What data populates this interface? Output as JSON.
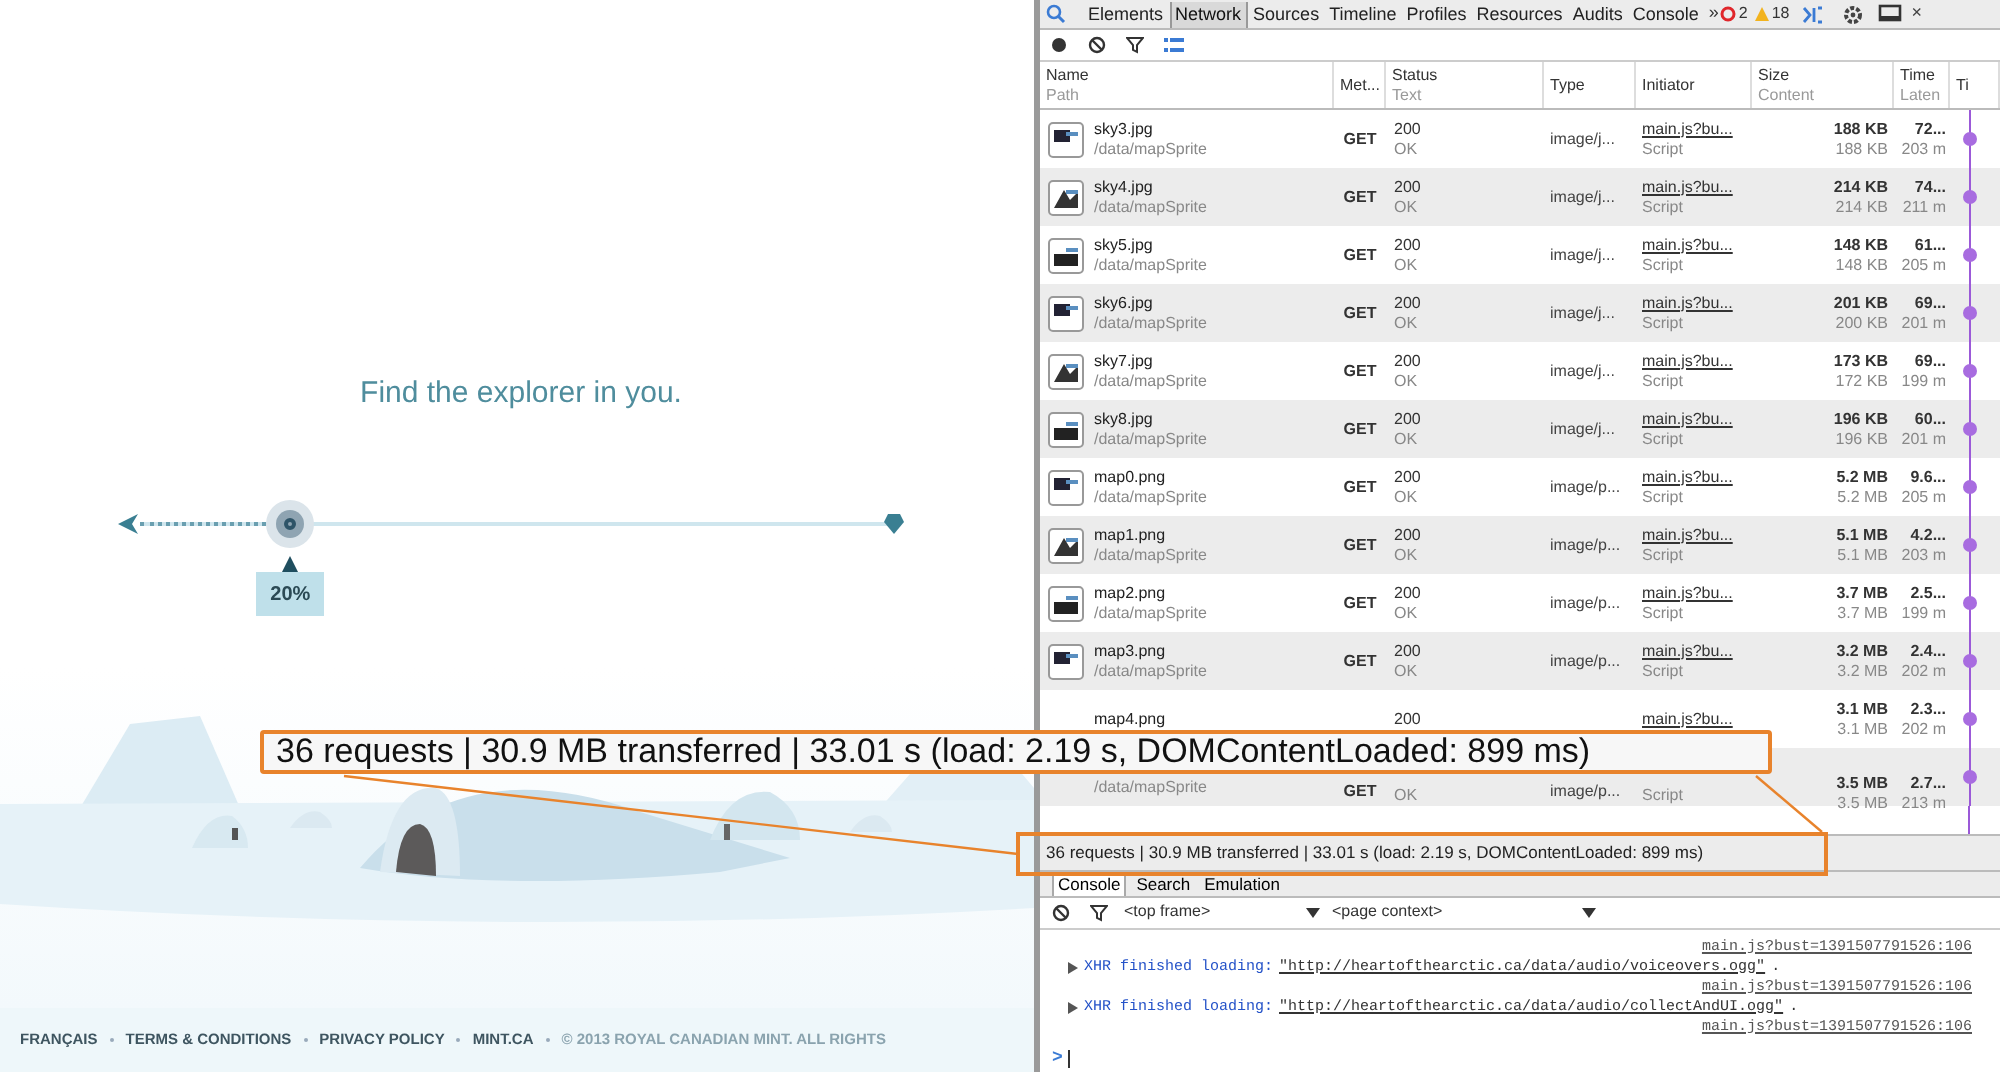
{
  "site": {
    "heading": "Find the explorer in you.",
    "slider": {
      "level": 0.2,
      "label": "20%"
    },
    "footer_links": [
      "FRANÇAIS",
      "TERMS & CONDITIONS",
      "PRIVACY POLICY",
      "MINT.CA"
    ],
    "copyright": "© 2013 ROYAL CANADIAN MINT. ALL RIGHTS"
  },
  "devtools": {
    "tabs": [
      {
        "label": "Elements",
        "selected": false
      },
      {
        "label": "Network",
        "selected": true
      },
      {
        "label": "Sources",
        "selected": false
      },
      {
        "label": "Timeline",
        "selected": false
      },
      {
        "label": "Profiles",
        "selected": false
      },
      {
        "label": "Resources",
        "selected": false
      },
      {
        "label": "Audits",
        "selected": false
      },
      {
        "label": "Console",
        "selected": false
      }
    ],
    "more": "»",
    "errors": "2",
    "warnings": "18",
    "close": "×",
    "columns": [
      {
        "title": "Name",
        "subtitle": "Path"
      },
      {
        "title": "Met..."
      },
      {
        "title": "Status",
        "subtitle": "Text"
      },
      {
        "title": "Type"
      },
      {
        "title": "Initiator"
      },
      {
        "title": "Size",
        "subtitle": "Content"
      },
      {
        "title": "Time",
        "subtitle": "Laten"
      },
      {
        "title": "Ti"
      }
    ],
    "rows": [
      {
        "name": "sky3.jpg",
        "path": "/data/mapSprite",
        "method": "GET",
        "status": "200",
        "status_text": "OK",
        "type": "image/j...",
        "initiator": "main.js?bu...",
        "initiator_type": "Script",
        "size": "188 KB",
        "content": "188 KB",
        "time": "72...",
        "latency": "203 m"
      },
      {
        "name": "sky4.jpg",
        "path": "/data/mapSprite",
        "method": "GET",
        "status": "200",
        "status_text": "OK",
        "type": "image/j...",
        "initiator": "main.js?bu...",
        "initiator_type": "Script",
        "size": "214 KB",
        "content": "214 KB",
        "time": "74...",
        "latency": "211 m"
      },
      {
        "name": "sky5.jpg",
        "path": "/data/mapSprite",
        "method": "GET",
        "status": "200",
        "status_text": "OK",
        "type": "image/j...",
        "initiator": "main.js?bu...",
        "initiator_type": "Script",
        "size": "148 KB",
        "content": "148 KB",
        "time": "61...",
        "latency": "205 m"
      },
      {
        "name": "sky6.jpg",
        "path": "/data/mapSprite",
        "method": "GET",
        "status": "200",
        "status_text": "OK",
        "type": "image/j...",
        "initiator": "main.js?bu...",
        "initiator_type": "Script",
        "size": "201 KB",
        "content": "200 KB",
        "time": "69...",
        "latency": "201 m"
      },
      {
        "name": "sky7.jpg",
        "path": "/data/mapSprite",
        "method": "GET",
        "status": "200",
        "status_text": "OK",
        "type": "image/j...",
        "initiator": "main.js?bu...",
        "initiator_type": "Script",
        "size": "173 KB",
        "content": "172 KB",
        "time": "69...",
        "latency": "199 m"
      },
      {
        "name": "sky8.jpg",
        "path": "/data/mapSprite",
        "method": "GET",
        "status": "200",
        "status_text": "OK",
        "type": "image/j...",
        "initiator": "main.js?bu...",
        "initiator_type": "Script",
        "size": "196 KB",
        "content": "196 KB",
        "time": "60...",
        "latency": "201 m"
      },
      {
        "name": "map0.png",
        "path": "/data/mapSprite",
        "method": "GET",
        "status": "200",
        "status_text": "OK",
        "type": "image/p...",
        "initiator": "main.js?bu...",
        "initiator_type": "Script",
        "size": "5.2 MB",
        "content": "5.2 MB",
        "time": "9.6...",
        "latency": "205 m"
      },
      {
        "name": "map1.png",
        "path": "/data/mapSprite",
        "method": "GET",
        "status": "200",
        "status_text": "OK",
        "type": "image/p...",
        "initiator": "main.js?bu...",
        "initiator_type": "Script",
        "size": "5.1 MB",
        "content": "5.1 MB",
        "time": "4.2...",
        "latency": "203 m"
      },
      {
        "name": "map2.png",
        "path": "/data/mapSprite",
        "method": "GET",
        "status": "200",
        "status_text": "OK",
        "type": "image/p...",
        "initiator": "main.js?bu...",
        "initiator_type": "Script",
        "size": "3.7 MB",
        "content": "3.7 MB",
        "time": "2.5...",
        "latency": "199 m"
      },
      {
        "name": "map3.png",
        "path": "/data/mapSprite",
        "method": "GET",
        "status": "200",
        "status_text": "OK",
        "type": "image/p...",
        "initiator": "main.js?bu...",
        "initiator_type": "Script",
        "size": "3.2 MB",
        "content": "3.2 MB",
        "time": "2.4...",
        "latency": "202 m"
      },
      {
        "name": "map4.png",
        "status": "200",
        "initiator": "main.js?bu...",
        "size": "3.1 MB",
        "content": "3.1 MB",
        "time": "2.3...",
        "latency": "202 m"
      },
      {
        "path": "/data/mapSprite",
        "method": "GET",
        "status_text": "OK",
        "type": "image/p...",
        "initiator_type": "Script",
        "size": "3.5 MB",
        "content": "3.5 MB",
        "time": "2.7...",
        "latency": "213 m"
      }
    ],
    "summary": "36 requests | 30.9 MB transferred | 33.01 s (load: 2.19 s, DOMContentLoaded: 899 ms)",
    "console_tabs": [
      {
        "label": "Console",
        "selected": true
      },
      {
        "label": "Search",
        "selected": false
      },
      {
        "label": "Emulation",
        "selected": false
      }
    ],
    "frame": "<top frame>",
    "context": "<page context>",
    "messages": [
      {
        "kind": "source",
        "source": "main.js?bust=1391507791526:106"
      },
      {
        "kind": "xhr",
        "label": "XHR finished loading:",
        "url": "\"http://heartofthearctic.ca/data/audio/voiceovers.ogg\"",
        "end": ".",
        "source": "main.js?bust=1391507791526:106"
      },
      {
        "kind": "xhr",
        "label": "XHR finished loading:",
        "url": "\"http://heartofthearctic.ca/data/audio/collectAndUI.ogg\"",
        "end": ".",
        "source": "main.js?bust=1391507791526:106"
      }
    ],
    "prompt": ">"
  },
  "callout": {
    "text": "36 requests | 30.9 MB transferred | 33.01 s (load: 2.19 s, DOMContentLoaded: 899 ms)"
  }
}
